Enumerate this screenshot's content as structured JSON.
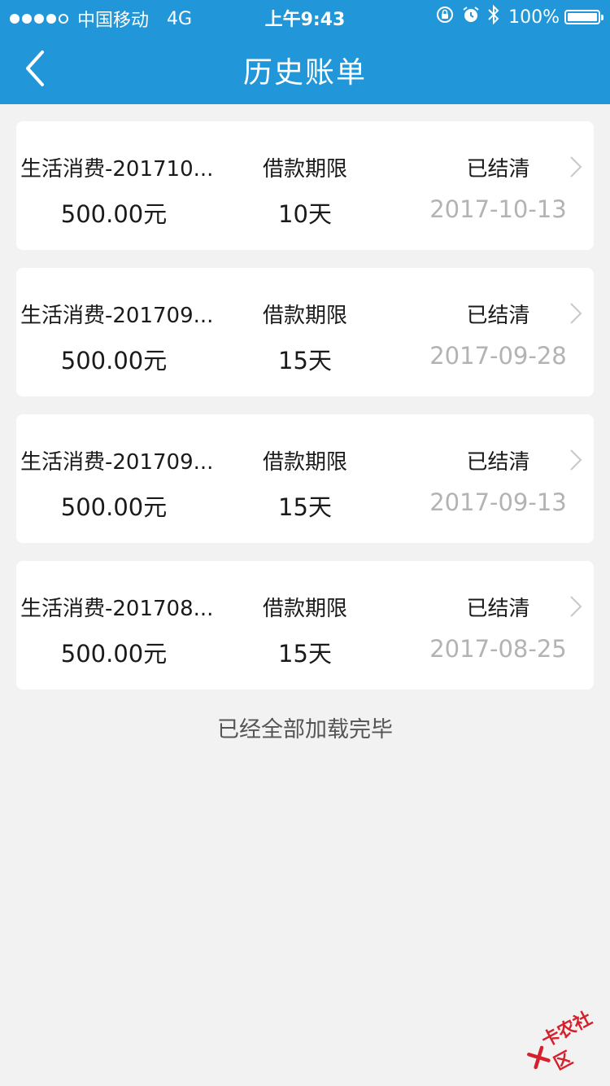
{
  "status_bar": {
    "carrier": "中国移动",
    "network": "4G",
    "time": "上午9:43",
    "battery_percent": "100%",
    "battery_level": 1.0
  },
  "nav": {
    "title": "历史账单",
    "back_icon": "chevron-left-icon"
  },
  "bills": [
    {
      "name": "生活消费-201710...",
      "amount": "500.00元",
      "term_label": "借款期限",
      "term": "10天",
      "status": "已结清",
      "date": "2017-10-13"
    },
    {
      "name": "生活消费-201709...",
      "amount": "500.00元",
      "term_label": "借款期限",
      "term": "15天",
      "status": "已结清",
      "date": "2017-09-28"
    },
    {
      "name": "生活消费-201709...",
      "amount": "500.00元",
      "term_label": "借款期限",
      "term": "15天",
      "status": "已结清",
      "date": "2017-09-13"
    },
    {
      "name": "生活消费-201708...",
      "amount": "500.00元",
      "term_label": "借款期限",
      "term": "15天",
      "status": "已结清",
      "date": "2017-08-25"
    }
  ],
  "footer": {
    "loaded_text": "已经全部加载完毕"
  },
  "watermark": {
    "text": "卡农社区"
  },
  "colors": {
    "header_bg": "#2196d8",
    "page_bg": "#f2f2f2",
    "card_bg": "#ffffff",
    "date_gray": "#b3b3b3",
    "watermark_red": "#d6202b"
  }
}
